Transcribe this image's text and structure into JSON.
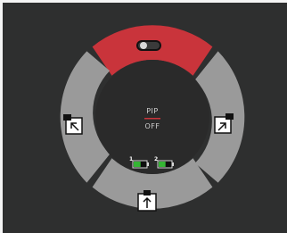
{
  "colors": {
    "background": "#2e2f2f",
    "top_segment": "#c9343b",
    "side_segment": "#9a9a9a",
    "center": "#2a2a2a",
    "battery_level": "#35b534"
  },
  "top_control": {
    "icon": "toggle-switch-icon",
    "state": "off"
  },
  "left_control": {
    "icon": "pip-move-left-icon"
  },
  "right_control": {
    "icon": "pip-move-right-icon"
  },
  "bottom_control": {
    "icon": "pip-swap-up-icon"
  },
  "status": {
    "pip_label": "PIP",
    "pip_state": "OFF"
  },
  "batteries": [
    {
      "label": "1",
      "level": 0.55
    },
    {
      "label": "2",
      "level": 0.55
    }
  ]
}
